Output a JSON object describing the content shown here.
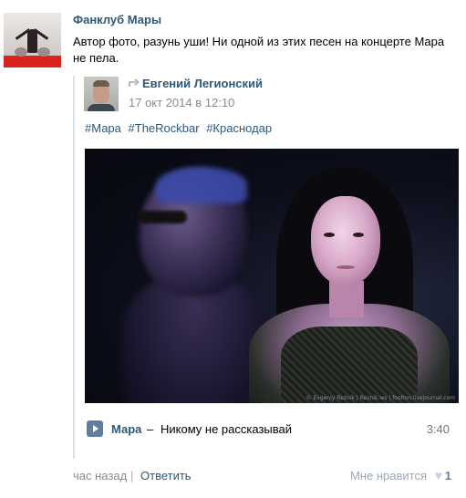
{
  "post": {
    "author": "Фанклуб Мары",
    "text": "Автор фото, разунь уши! Ни одной из этих песен на концерте Мара не пела.",
    "time": "час назад",
    "separator": "|",
    "reply_label": "Ответить",
    "like_label": "Мне нравится",
    "like_count": "1"
  },
  "repost": {
    "author": "Евгений Легионский",
    "date": "17 окт 2014 в 12:10",
    "tags": [
      "#Мара",
      "#TheRockbar",
      "#Краснодар"
    ],
    "photo_watermark": "© Evgeniy Reznik | Reznik.ws | foolton.livejournal.com",
    "audio": {
      "artist": "Мара",
      "separator": "–",
      "title": "Никому не рассказывай",
      "duration": "3:40"
    }
  },
  "icons": {
    "repost": "repost-arrow-icon",
    "play": "play-icon",
    "like": "heart-icon"
  },
  "colors": {
    "link": "#2b587a",
    "muted": "#8a8a8a",
    "accent": "#5f7fa0"
  }
}
